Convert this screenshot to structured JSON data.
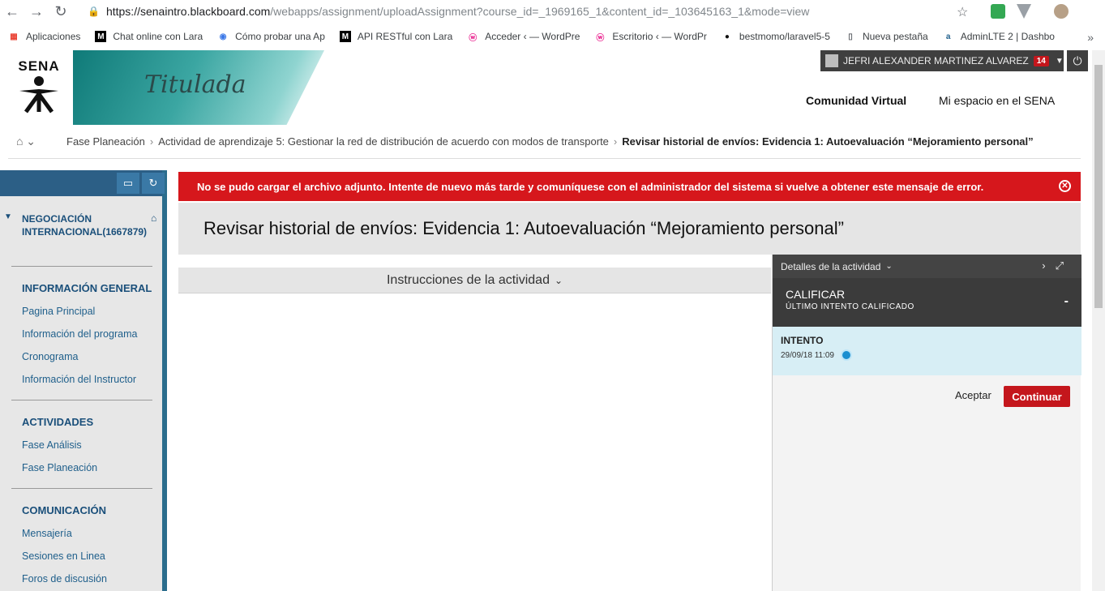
{
  "browser": {
    "url_host": "https://senaintro.blackboard.com",
    "url_path": "/webapps/assignment/uploadAssignment?course_id=_1969165_1&content_id=_103645163_1&mode=view",
    "bookmarks": [
      {
        "label": "Aplicaciones",
        "icon": "apps-grid-icon"
      },
      {
        "label": "Chat online con Lara",
        "icon": "medium-icon"
      },
      {
        "label": "Cómo probar una Ap",
        "icon": "blog-icon"
      },
      {
        "label": "API RESTful con Lara",
        "icon": "medium-icon"
      },
      {
        "label": "Acceder ‹ — WordPre",
        "icon": "wordpress-icon"
      },
      {
        "label": "Escritorio ‹ — WordPr",
        "icon": "wordpress-icon"
      },
      {
        "label": "bestmomo/laravel5-5",
        "icon": "github-icon"
      },
      {
        "label": "Nueva pestaña",
        "icon": "page-icon"
      },
      {
        "label": "AdminLTE 2 | Dashbo",
        "icon": "adminlte-icon"
      }
    ],
    "more": "»"
  },
  "header": {
    "logo_text": "SENA",
    "brand": "Titulada",
    "user_name": "JEFRI ALEXANDER MARTINEZ ALVAREZ",
    "notifications": "14",
    "nav": [
      "Comunidad Virtual",
      "Mi espacio en el SENA"
    ]
  },
  "breadcrumb": {
    "items": [
      "Fase Planeación",
      "Actividad de aprendizaje 5: Gestionar la red de distribución de acuerdo con modos de transporte"
    ],
    "current": "Revisar historial de envíos: Evidencia 1: Autoevaluación “Mejoramiento personal”"
  },
  "sidebar": {
    "course": "NEGOCIACIÓN INTERNACIONAL(1667879)",
    "sections": [
      {
        "title": "INFORMACIÓN GENERAL",
        "items": [
          "Pagina Principal",
          "Información del programa",
          "Cronograma",
          "Información del Instructor"
        ]
      },
      {
        "title": "ACTIVIDADES",
        "items": [
          "Fase Análisis",
          "Fase Planeación"
        ]
      },
      {
        "title": "COMUNICACIÓN",
        "items": [
          "Mensajería",
          "Sesiones en Linea",
          "Foros de discusión"
        ]
      }
    ]
  },
  "alert": {
    "message": "No se pudo cargar el archivo adjunto. Intente de nuevo más tarde y comuníquese con el administrador del sistema si vuelve a obtener este mensaje de error."
  },
  "main": {
    "title": "Revisar historial de envíos: Evidencia 1: Autoevaluación “Mejoramiento personal”",
    "instructions_label": "Instrucciones de la actividad"
  },
  "panel": {
    "details_label": "Detalles de la actividad",
    "grade_title": "CALIFICAR",
    "grade_sub": "ÚLTIMO INTENTO CALIFICADO",
    "grade_value": "-",
    "attempt_title": "INTENTO",
    "attempt_date": "29/09/18 11:09",
    "accept_label": "Aceptar",
    "continue_label": "Continuar"
  },
  "colors": {
    "alert_red": "#d6171c",
    "brand_blue": "#1a4f7a",
    "button_red": "#c4161c"
  }
}
